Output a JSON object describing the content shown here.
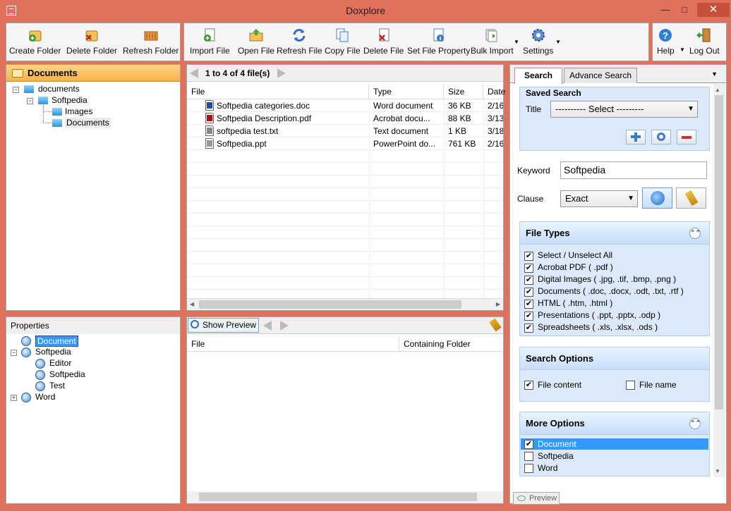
{
  "window": {
    "title": "Doxplore"
  },
  "toolbar_left": [
    {
      "label": "Create Folder",
      "icon": "create-folder-icon"
    },
    {
      "label": "Delete Folder",
      "icon": "delete-folder-icon"
    },
    {
      "label": "Refresh Folder",
      "icon": "refresh-folder-icon"
    }
  ],
  "toolbar_mid": [
    {
      "label": "Import File",
      "icon": "import-file-icon"
    },
    {
      "label": "Open File",
      "icon": "open-file-icon"
    },
    {
      "label": "Refresh File",
      "icon": "refresh-file-icon"
    },
    {
      "label": "Copy File",
      "icon": "copy-file-icon"
    },
    {
      "label": "Delete File",
      "icon": "delete-file-icon"
    },
    {
      "label": "Set File Property",
      "icon": "set-file-property-icon"
    },
    {
      "label": "Bulk Import",
      "icon": "bulk-import-icon"
    },
    {
      "label": "Settings",
      "icon": "settings-icon"
    }
  ],
  "toolbar_right": [
    {
      "label": "Help",
      "icon": "help-icon"
    },
    {
      "label": "Log Out",
      "icon": "logout-icon"
    }
  ],
  "folders": {
    "header": "Documents",
    "tree": [
      "documents",
      "Softpedia",
      "Images",
      "Documents"
    ]
  },
  "properties": {
    "title": "Properties",
    "tree": [
      "Document",
      "Softpedia",
      "Editor",
      "Softpedia",
      "Test",
      "Word"
    ]
  },
  "files": {
    "pager": "1 to 4 of 4 file(s)",
    "columns": [
      "File",
      "Type",
      "Size",
      "Date"
    ],
    "rows": [
      {
        "name": "Softpedia categories.doc",
        "type": "Word document",
        "size": "36 KB",
        "date": "2/16"
      },
      {
        "name": "Softpedia Description.pdf",
        "type": "Acrobat docu...",
        "size": "88 KB",
        "date": "3/13"
      },
      {
        "name": "softpedia test.txt",
        "type": "Text document",
        "size": "1 KB",
        "date": "3/18"
      },
      {
        "name": "Softpedia.ppt",
        "type": "PowerPoint do...",
        "size": "761 KB",
        "date": "2/16"
      }
    ]
  },
  "preview": {
    "show_label": "Show Preview",
    "columns": [
      "File",
      "Containing Folder"
    ],
    "bottom_tab": "Preview"
  },
  "search": {
    "tabs": [
      "Search",
      "Advance Search"
    ],
    "saved_search_title": "Saved Search",
    "title_label": "Title",
    "title_select": "---------- Select ---------",
    "keyword_label": "Keyword",
    "keyword_value": "Softpedia",
    "clause_label": "Clause",
    "clause_value": "Exact",
    "file_types_title": "File Types",
    "file_types": [
      {
        "label": "Select / Unselect  All",
        "checked": true
      },
      {
        "label": "Acrobat PDF ( .pdf )",
        "checked": true
      },
      {
        "label": "Digital Images ( .jpg, .tif, .bmp, .png )",
        "checked": true
      },
      {
        "label": "Documents ( .doc, .docx, .odt, .txt, .rtf )",
        "checked": true
      },
      {
        "label": "HTML ( .htm, .html )",
        "checked": true
      },
      {
        "label": "Presentations ( .ppt, .pptx, .odp )",
        "checked": true
      },
      {
        "label": "Spreadsheets ( .xls, .xlsx, .ods )",
        "checked": true
      }
    ],
    "search_options_title": "Search Options",
    "file_content_label": "File content",
    "file_name_label": "File name",
    "more_options_title": "More Options",
    "more_options": [
      {
        "label": "Document",
        "checked": true
      },
      {
        "label": "Softpedia",
        "checked": false
      },
      {
        "label": "Word",
        "checked": false
      }
    ]
  },
  "colors": {
    "window_frame": "#e1705c",
    "header_orange": "#f9b342",
    "panel_blue": "#dce9fa",
    "selection": "#3399ff"
  }
}
